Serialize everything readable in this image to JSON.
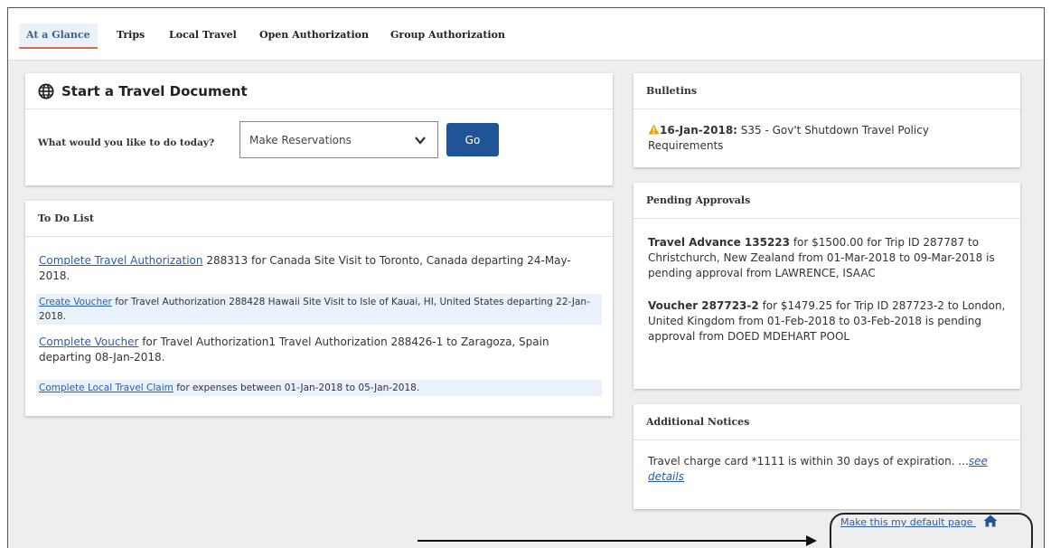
{
  "tabs": [
    "At a Glance",
    "Trips",
    "Local Travel",
    "Open Authorization",
    "Group Authorization"
  ],
  "start_doc": {
    "title": "Start a Travel Document",
    "prompt": "What would you like to do today?",
    "select_value": "Make Reservations",
    "go_label": "Go"
  },
  "todo": {
    "title": "To Do List",
    "items": [
      {
        "link": "Complete Travel Authorization",
        "text": " 288313 for Canada Site Visit to Toronto, Canada departing 24-May-2018."
      },
      {
        "link": "Create Voucher",
        "text": " for Travel Authorization 288428 Hawaii Site Visit to Isle of Kauai, HI, United States departing 22-Jan-2018."
      },
      {
        "link": "Complete Voucher",
        "text": " for Travel Authorization1 Travel Authorization 288426-1 to Zaragoza, Spain departing 08-Jan-2018."
      },
      {
        "link": "Complete Local Travel Claim",
        "text": " for expenses between 01-Jan-2018 to 05-Jan-2018."
      }
    ]
  },
  "bulletins": {
    "title": "Bulletins",
    "date": "16-Jan-2018:",
    "text": " S35 - Gov't Shutdown Travel Policy Requirements"
  },
  "pending": {
    "title": "Pending Approvals",
    "items": [
      {
        "head": "Travel Advance 135223",
        "text": " for $1500.00 for Trip ID 287787 to Christchurch, New Zealand from 01-Mar-2018 to 09-Mar-2018 is pending approval from LAWRENCE, ISAAC"
      },
      {
        "head": "Voucher 287723-2",
        "text": " for $1479.25 for Trip ID 287723-2 to London, United Kingdom from 01-Feb-2018 to 03-Feb-2018 is pending approval from DOED MDEHART POOL"
      }
    ]
  },
  "notices": {
    "title": "Additional Notices",
    "text": "Travel charge card *1111 is within 30 days of expiration. ",
    "prefix": "...",
    "link": "see details"
  },
  "default_page_link": "Make this my default page",
  "colors": {
    "primary_button": "#1f5496",
    "link": "#2a5db0",
    "active_tab_underline": "#e06a4a",
    "warning": "#e0a800"
  }
}
